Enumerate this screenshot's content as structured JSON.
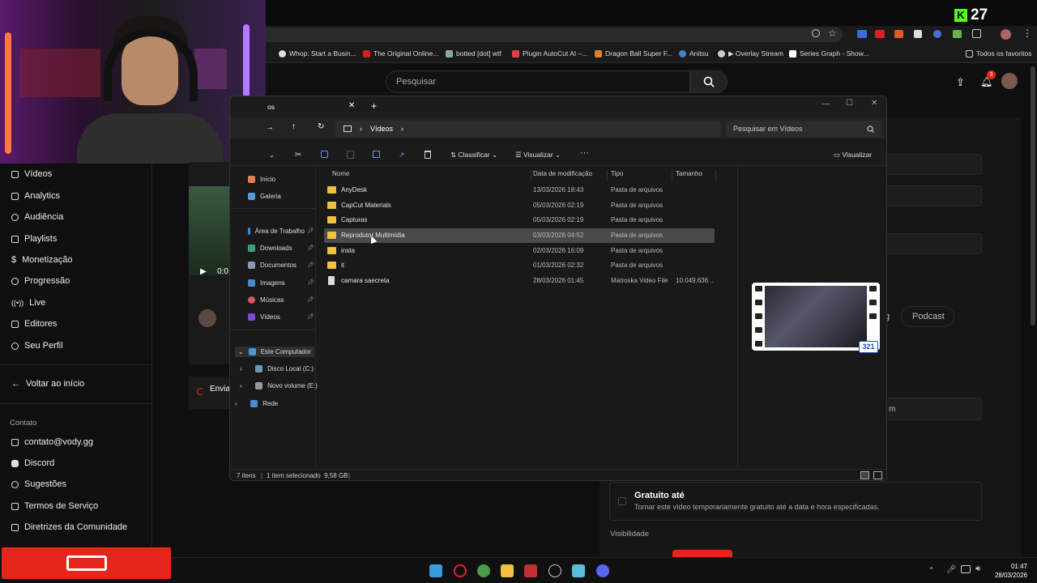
{
  "overlay": {
    "kick_viewers": "27"
  },
  "bookmarks": [
    {
      "label": "Whop: Start a Busin..."
    },
    {
      "label": "The Original Online..."
    },
    {
      "label": "botted [dot] wtf"
    },
    {
      "label": "Plugin AutoCut AI –..."
    },
    {
      "label": "Dragon Ball Super F..."
    },
    {
      "label": "Anitsu"
    },
    {
      "label": "▶ Overlay Stream"
    },
    {
      "label": "Series Graph - Show..."
    }
  ],
  "bookmarks_all": "Todos os favoritos",
  "youtube": {
    "search_placeholder": "Pesquisar",
    "notifications_count": "3",
    "sidebar": [
      {
        "label": "Vídeos"
      },
      {
        "label": "Analytics"
      },
      {
        "label": "Audiência"
      },
      {
        "label": "Playlists"
      },
      {
        "label": "Monetização"
      },
      {
        "label": "Progressão"
      },
      {
        "label": "Live"
      },
      {
        "label": "Editores"
      },
      {
        "label": "Seu Perfil"
      }
    ],
    "back_label": "Voltar ao início",
    "contact_heading": "Contato",
    "contact": [
      {
        "label": "contato@vody.gg"
      },
      {
        "label": "Discord"
      },
      {
        "label": "Sugestões"
      },
      {
        "label": "Termos de Serviço"
      },
      {
        "label": "Diretrizes da Comunidade"
      }
    ],
    "player_time": "0:0",
    "upload_status": "Envia",
    "category_chip": "Podcast",
    "chip_partial": "g",
    "field_partial": "m",
    "free_title": "Gratuito até",
    "free_desc": "Tornar este vídeo temporariamente gratuito até a data e hora especificadas.",
    "visibility_label": "Visibilidade"
  },
  "explorer": {
    "tab_title": "os",
    "path": [
      "Vídeos"
    ],
    "search_placeholder": "Pesquisar em Vídeos",
    "toolbar": {
      "sort": "Classificar",
      "view": "Visualizar",
      "more": "···",
      "preview": "Visualizar"
    },
    "nav": [
      {
        "label": "Início"
      },
      {
        "label": "Galeria"
      },
      {
        "label": "Área de Trabalho"
      },
      {
        "label": "Downloads"
      },
      {
        "label": "Documentos"
      },
      {
        "label": "Imagens"
      },
      {
        "label": "Músicas"
      },
      {
        "label": "Vídeos"
      },
      {
        "label": "Este Computador"
      },
      {
        "label": "Disco Local (C:)"
      },
      {
        "label": "Novo volume (E:)"
      },
      {
        "label": "Rede"
      }
    ],
    "columns": [
      "Nome",
      "Data de modificação",
      "Tipo",
      "Tamanho"
    ],
    "rows": [
      {
        "name": "AnyDesk",
        "date": "13/03/2026 18:43",
        "type": "Pasta de arquivos",
        "size": "",
        "kind": "folder",
        "selected": false
      },
      {
        "name": "CapCut Materials",
        "date": "05/03/2026 02:19",
        "type": "Pasta de arquivos",
        "size": "",
        "kind": "folder",
        "selected": false
      },
      {
        "name": "Capturas",
        "date": "05/03/2026 02:19",
        "type": "Pasta de arquivos",
        "size": "",
        "kind": "folder",
        "selected": false
      },
      {
        "name": "Reprodutor Multimídia",
        "date": "03/03/2026 04:52",
        "type": "Pasta de arquivos",
        "size": "",
        "kind": "folder",
        "selected": true
      },
      {
        "name": "insta",
        "date": "02/03/2026 16:09",
        "type": "Pasta de arquivos",
        "size": "",
        "kind": "folder",
        "selected": false
      },
      {
        "name": "it",
        "date": "01/03/2026 02:32",
        "type": "Pasta de arquivos",
        "size": "",
        "kind": "folder",
        "selected": false
      },
      {
        "name": "camara saecreta",
        "date": "28/03/2026 01:45",
        "type": "Matroska Video File",
        "size": "10.049.636 ...",
        "kind": "file",
        "selected": false
      }
    ],
    "status": {
      "count": "7 itens",
      "selected": "1 item selecionado  9,58 GB"
    }
  },
  "preview_badge": "321",
  "clock": {
    "time": "01:47",
    "date": "28/03/2026"
  }
}
